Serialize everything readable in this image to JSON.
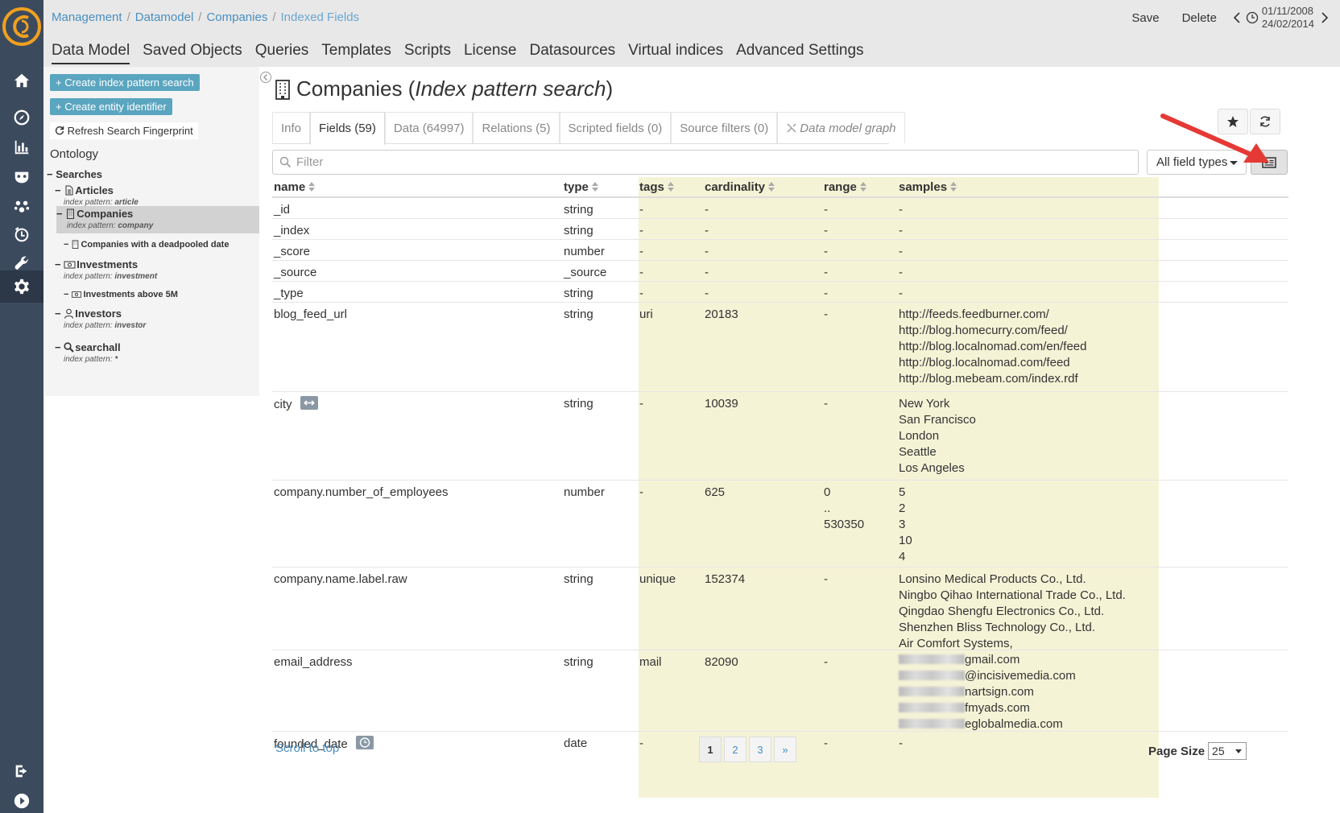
{
  "breadcrumbs": [
    "Management",
    "Datamodel",
    "Companies",
    "Indexed Fields"
  ],
  "header_actions": {
    "save": "Save",
    "delete": "Delete",
    "date_from": "01/11/2008",
    "date_to": "24/02/2014"
  },
  "top_tabs": [
    "Data Model",
    "Saved Objects",
    "Queries",
    "Templates",
    "Scripts",
    "License",
    "Datasources",
    "Virtual indices",
    "Advanced Settings"
  ],
  "sidebar": {
    "create_search": "+ Create index pattern search",
    "create_entity": "+ Create entity identifier",
    "refresh": "Refresh Search Fingerprint",
    "ontology": "Ontology",
    "searches": "Searches",
    "nodes": [
      {
        "label": "Articles",
        "pattern_prefix": "index pattern: ",
        "pattern": "article"
      },
      {
        "label": "Companies",
        "pattern_prefix": "index pattern: ",
        "pattern": "company"
      },
      {
        "label": "Companies with a deadpooled date"
      },
      {
        "label": "Investments",
        "pattern_prefix": "index pattern: ",
        "pattern": "investment"
      },
      {
        "label": "Investments above 5M"
      },
      {
        "label": "Investors",
        "pattern_prefix": "index pattern: ",
        "pattern": "investor"
      },
      {
        "label": "searchall",
        "pattern_prefix": "index pattern: ",
        "pattern": "*"
      }
    ]
  },
  "main": {
    "title": "Companies (",
    "title_italic": "Index pattern search",
    "title_end": ")",
    "tabs": [
      "Info",
      "Fields (59)",
      "Data (64997)",
      "Relations (5)",
      "Scripted fields (0)",
      "Source filters (0)",
      "Data model graph"
    ],
    "filter_placeholder": "Filter",
    "field_types": "All field types"
  },
  "table": {
    "headers": [
      "name",
      "type",
      "tags",
      "cardinality",
      "range",
      "samples"
    ],
    "rows": [
      {
        "name": "_id",
        "type": "string",
        "tags": "-",
        "cardinality": "-",
        "range": "-",
        "samples": "-"
      },
      {
        "name": "_index",
        "type": "string",
        "tags": "-",
        "cardinality": "-",
        "range": "-",
        "samples": "-"
      },
      {
        "name": "_score",
        "type": "number",
        "tags": "-",
        "cardinality": "-",
        "range": "-",
        "samples": "-"
      },
      {
        "name": "_source",
        "type": "_source",
        "tags": "-",
        "cardinality": "-",
        "range": "-",
        "samples": "-"
      },
      {
        "name": "_type",
        "type": "string",
        "tags": "-",
        "cardinality": "-",
        "range": "-",
        "samples": "-"
      },
      {
        "name": "blog_feed_url",
        "type": "string",
        "tags": "uri",
        "cardinality": "20183",
        "range": "-",
        "samples": [
          "http://feeds.feedburner.com/",
          "http://blog.homecurry.com/feed/",
          "http://blog.localnomad.com/en/feed",
          "http://blog.localnomad.com/feed",
          "http://blog.mebeam.com/index.rdf"
        ]
      },
      {
        "name": "city",
        "type": "string",
        "tags": "-",
        "cardinality": "10039",
        "range": "-",
        "samples": [
          "New York",
          "San Francisco",
          "London",
          "Seattle",
          "Los Angeles"
        ]
      },
      {
        "name": "company.number_of_employees",
        "type": "number",
        "tags": "-",
        "cardinality": "625",
        "range": [
          "0",
          "..",
          "530350"
        ],
        "samples": [
          "5",
          "2",
          "3",
          "10",
          "4"
        ]
      },
      {
        "name": "company.name.label.raw",
        "type": "string",
        "tags": "unique",
        "cardinality": "152374",
        "range": "-",
        "samples": [
          "Lonsino Medical Products Co., Ltd.",
          "Ningbo Qihao International Trade Co., Ltd.",
          "Qingdao Shengfu Electronics Co., Ltd.",
          "Shenzhen Bliss Technology Co., Ltd.",
          "Air Comfort Systems,"
        ]
      },
      {
        "name": "email_address",
        "type": "string",
        "tags": "mail",
        "cardinality": "82090",
        "range": "-",
        "samples": [
          "gmail.com",
          "@incisivemedia.com",
          "nartsign.com",
          "fmyads.com",
          "eglobalmedia.com"
        ]
      },
      {
        "name": "founded_date",
        "type": "date",
        "tags": "-",
        "cardinality": "-",
        "range": "-",
        "samples": "-"
      }
    ]
  },
  "footer": {
    "scroll_top": "Scroll to top",
    "pages": [
      "1",
      "2",
      "3",
      "»"
    ],
    "page_size_label": "Page Size",
    "page_size": "25"
  },
  "colors": {
    "rail": "#3c4a5d",
    "accent": "#5aa5bf",
    "highlight": "#f5f3d6",
    "arrow": "#e53935"
  }
}
